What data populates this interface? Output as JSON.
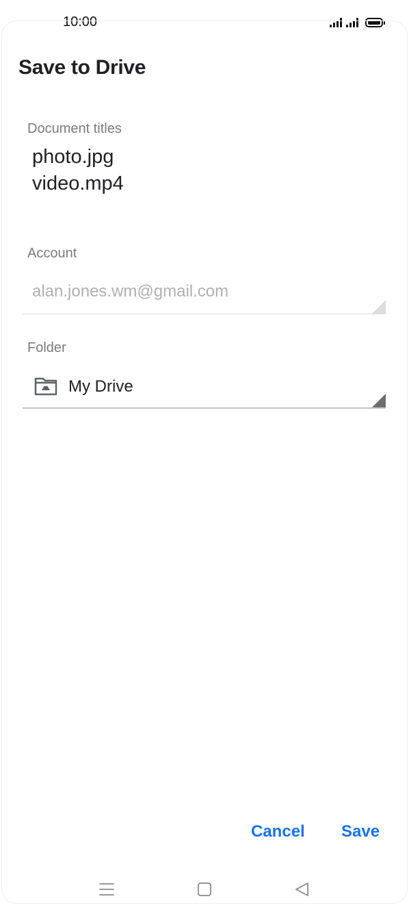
{
  "status_bar": {
    "time": "10:00"
  },
  "dialog": {
    "title": "Save to Drive",
    "document_titles": {
      "label": "Document titles",
      "items": [
        "photo.jpg",
        "video.mp4"
      ]
    },
    "account": {
      "label": "Account",
      "value": "alan.jones.wm@gmail.com"
    },
    "folder": {
      "label": "Folder",
      "value": "My Drive",
      "icon": "drive-folder-icon"
    },
    "actions": {
      "cancel_label": "Cancel",
      "save_label": "Save"
    }
  },
  "nav_bar": {
    "icons": [
      "menu-icon",
      "home-icon",
      "back-icon"
    ]
  },
  "colors": {
    "accent": "#1a73e8",
    "text_primary": "#202124",
    "label": "#7a7a7a",
    "disabled_text": "#b0b0b0"
  }
}
